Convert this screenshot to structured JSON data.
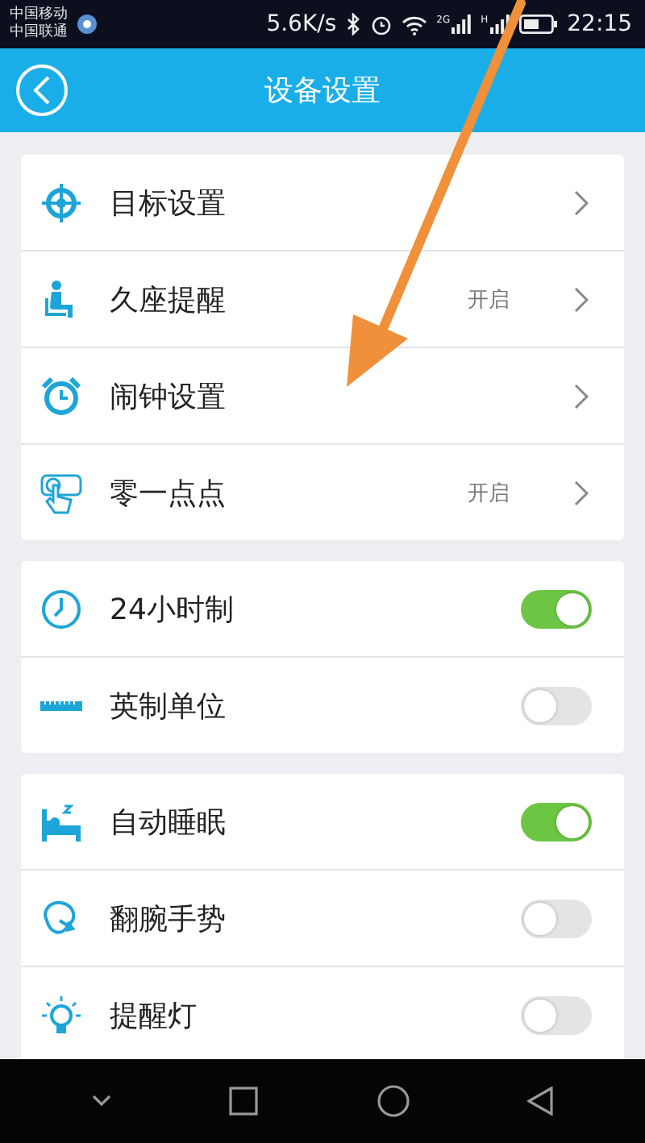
{
  "status_bar": {
    "carriers": [
      "中国移动",
      "中国联通"
    ],
    "speed": "5.6K/s",
    "signals": [
      "2G",
      "H"
    ],
    "time": "22:15"
  },
  "header": {
    "title": "设备设置"
  },
  "groups": [
    {
      "items": [
        {
          "kind": "link",
          "label": "目标设置"
        },
        {
          "kind": "link",
          "label": "久座提醒",
          "value": "开启"
        },
        {
          "kind": "link",
          "label": "闹钟设置"
        },
        {
          "kind": "link",
          "label": "零一点点",
          "value": "开启"
        }
      ]
    },
    {
      "items": [
        {
          "kind": "toggle",
          "label": "24小时制",
          "on": true
        },
        {
          "kind": "toggle",
          "label": "英制单位",
          "on": false
        }
      ]
    },
    {
      "items": [
        {
          "kind": "toggle",
          "label": "自动睡眠",
          "on": true
        },
        {
          "kind": "toggle",
          "label": "翻腕手势",
          "on": false
        },
        {
          "kind": "toggle",
          "label": "提醒灯",
          "on": false
        }
      ]
    }
  ]
}
